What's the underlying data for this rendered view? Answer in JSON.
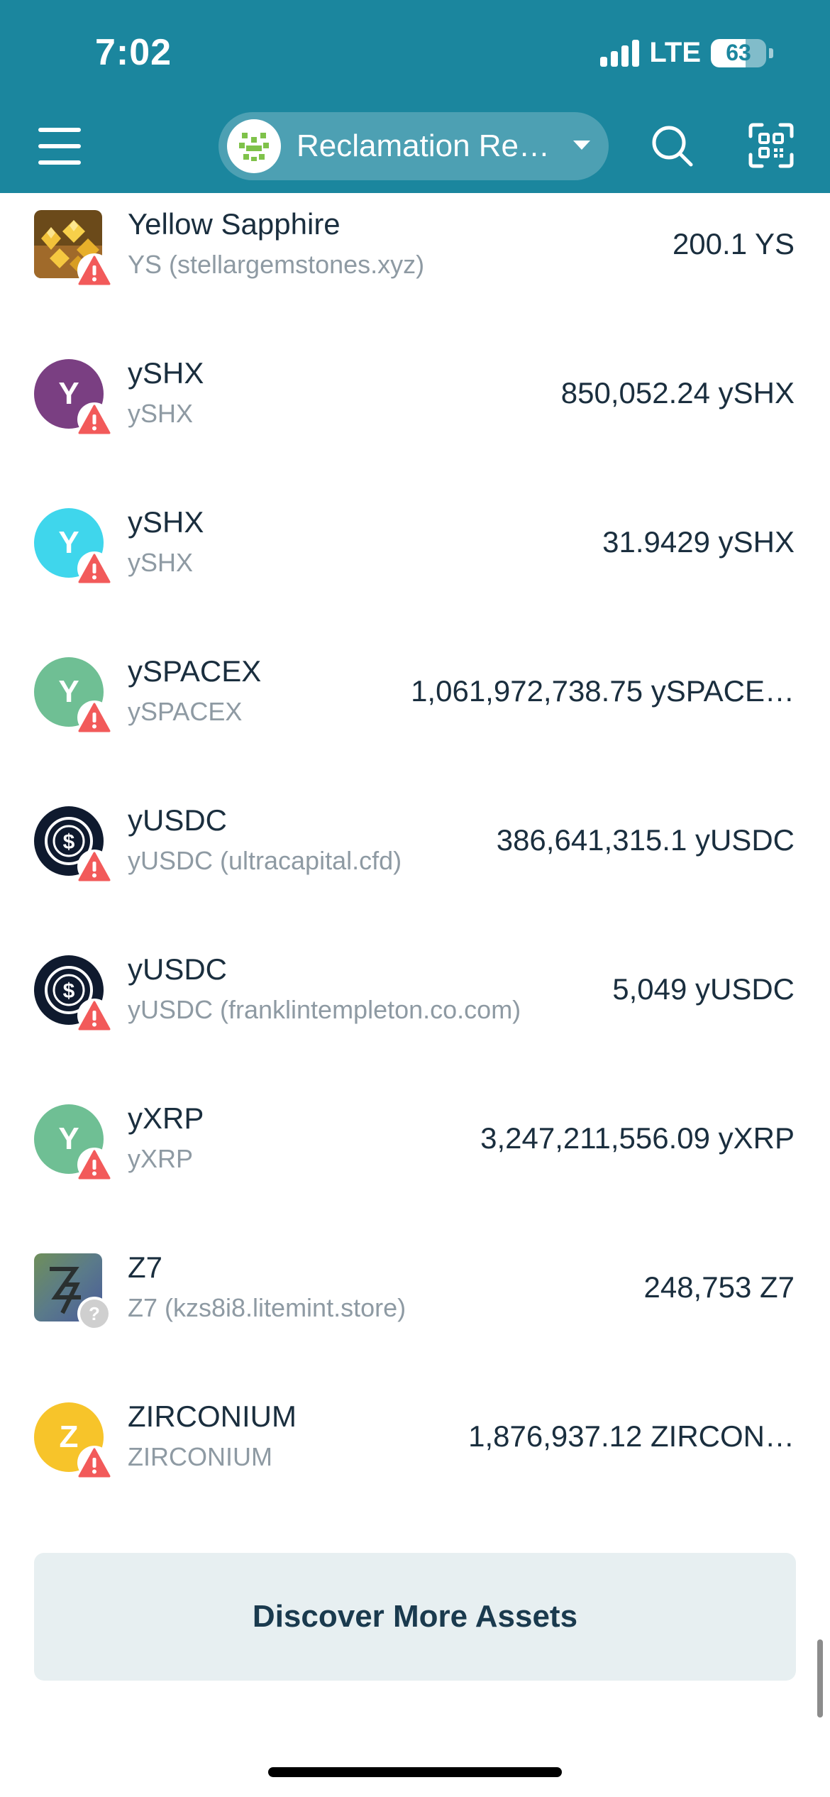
{
  "status_bar": {
    "time": "7:02",
    "network": "LTE",
    "battery": "63",
    "battery_level": 0.63
  },
  "header": {
    "account_name": "Reclamation Re…",
    "menu_icon": "hamburger-menu-icon",
    "search_icon": "search-icon",
    "scan_icon": "qr-scan-icon"
  },
  "colors": {
    "header_bg": "#1b869e",
    "warning_badge": "#f25a5a",
    "unknown_badge": "#cfcfcf"
  },
  "assets": [
    {
      "name": "Yellow Sapphire",
      "sub": "YS (stellargemstones.xyz)",
      "amount": "200.1 YS",
      "icon": "gem-image",
      "badge": "warning-icon"
    },
    {
      "name": "ySHX",
      "sub": "ySHX",
      "amount": "850,052.24 ySHX",
      "icon": "Y",
      "icon_color": "#7a3f82",
      "badge": "warning-icon"
    },
    {
      "name": "ySHX",
      "sub": "ySHX",
      "amount": "31.9429 ySHX",
      "icon": "Y",
      "icon_color": "#3fd6ec",
      "badge": "warning-icon"
    },
    {
      "name": "ySPACEX",
      "sub": "ySPACEX",
      "amount": "1,061,972,738.75 ySPACE…",
      "icon": "Y",
      "icon_color": "#6fbf94",
      "badge": "warning-icon"
    },
    {
      "name": "yUSDC",
      "sub": "yUSDC (ultracapital.cfd)",
      "amount": "386,641,315.1 yUSDC",
      "icon": "usdc-icon",
      "badge": "warning-icon"
    },
    {
      "name": "yUSDC",
      "sub": "yUSDC (franklintempleton.co.com)",
      "amount": "5,049 yUSDC",
      "icon": "usdc-icon",
      "badge": "warning-icon"
    },
    {
      "name": "yXRP",
      "sub": "yXRP",
      "amount": "3,247,211,556.09 yXRP",
      "icon": "Y",
      "icon_color": "#6fbf94",
      "badge": "warning-icon"
    },
    {
      "name": "Z7",
      "sub": "Z7 (kzs8i8.litemint.store)",
      "amount": "248,753 Z7",
      "icon": "z7-image",
      "badge": "question-icon"
    },
    {
      "name": "ZIRCONIUM",
      "sub": "ZIRCONIUM",
      "amount": "1,876,937.12 ZIRCON…",
      "icon": "Z",
      "icon_color": "#f7c42a",
      "badge": "warning-icon"
    }
  ],
  "discover_button": "Discover More Assets"
}
